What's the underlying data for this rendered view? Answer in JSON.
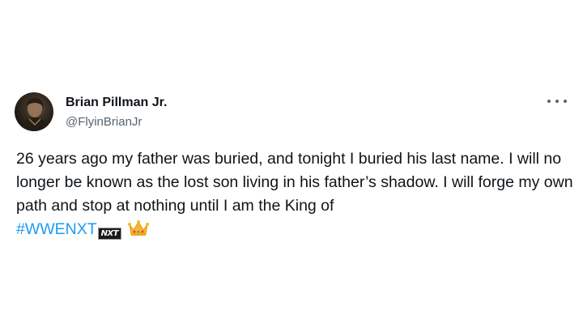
{
  "tweet": {
    "author_name": "Brian Pillman Jr.",
    "author_handle": "@FlyinBrianJr",
    "text_main": "26 years ago my father was buried, and tonight I buried his last name. I will no longer be known as the lost son living in his father’s shadow. I will forge my own path and stop at nothing until I am the King of",
    "hashtag": "#WWENXT",
    "hashtag_badge": "NXT",
    "hashtag_color": "#1d9bf0",
    "emoji": "crown-emoji",
    "more_icon": "more-options-icon"
  }
}
